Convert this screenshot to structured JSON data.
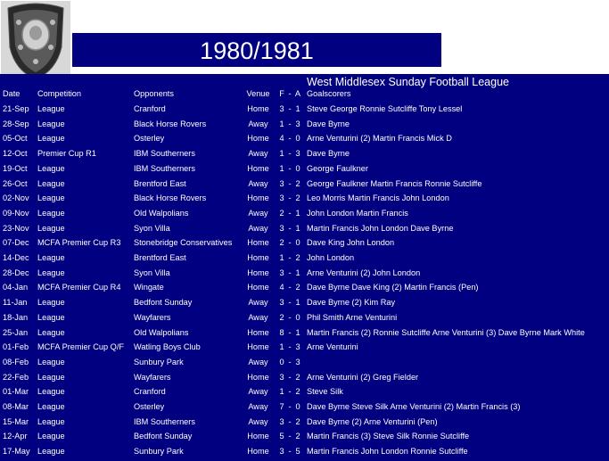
{
  "season_title": "1980/1981",
  "league_name": "West Middlesex Sunday Football League",
  "headers": {
    "date": "Date",
    "competition": "Competition",
    "opponents": "Opponents",
    "venue": "Venue",
    "f": "F",
    "dash": "-",
    "a": "A",
    "goalscorers": "Goalscorers"
  },
  "matches": [
    {
      "date": "21-Sep",
      "competition": "League",
      "opponents": "Cranford",
      "venue": "Home",
      "f": "3",
      "a": "1",
      "goalscorers": "Steve George Ronnie Sutcliffe Tony Lessel"
    },
    {
      "date": "28-Sep",
      "competition": "League",
      "opponents": "Black Horse Rovers",
      "venue": "Away",
      "f": "1",
      "a": "3",
      "goalscorers": "Dave Byrne"
    },
    {
      "date": "05-Oct",
      "competition": "League",
      "opponents": "Osterley",
      "venue": "Home",
      "f": "4",
      "a": "0",
      "goalscorers": "Arne Venturini (2) Martin Francis  Mick D"
    },
    {
      "date": "12-Oct",
      "competition": "Premier Cup R1",
      "opponents": "IBM Southerners",
      "venue": "Away",
      "f": "1",
      "a": "3",
      "goalscorers": "Dave Byrne"
    },
    {
      "date": "19-Oct",
      "competition": "League",
      "opponents": "IBM Southerners",
      "venue": "Home",
      "f": "1",
      "a": "0",
      "goalscorers": "George Faulkner"
    },
    {
      "date": "26-Oct",
      "competition": "League",
      "opponents": "Brentford East",
      "venue": "Away",
      "f": "3",
      "a": "2",
      "goalscorers": "George Faulkner Martin Francis Ronnie Sutcliffe"
    },
    {
      "date": "02-Nov",
      "competition": "League",
      "opponents": "Black Horse Rovers",
      "venue": "Home",
      "f": "3",
      "a": "2",
      "goalscorers": "Leo Morris Martin Francis John London"
    },
    {
      "date": "09-Nov",
      "competition": "League",
      "opponents": "Old Walpolians",
      "venue": "Away",
      "f": "2",
      "a": "1",
      "goalscorers": "John London Martin Francis"
    },
    {
      "date": "23-Nov",
      "competition": "League",
      "opponents": "Syon Villa",
      "venue": "Away",
      "f": "3",
      "a": "1",
      "goalscorers": "Martin Francis John London Dave Byrne"
    },
    {
      "date": "07-Dec",
      "competition": "MCFA Premier Cup R3",
      "opponents": "Stonebridge Conservatives",
      "venue": "Home",
      "f": "2",
      "a": "0",
      "goalscorers": "Dave King John London"
    },
    {
      "date": "14-Dec",
      "competition": "League",
      "opponents": "Brentford East",
      "venue": "Home",
      "f": "1",
      "a": "2",
      "goalscorers": "John London"
    },
    {
      "date": "28-Dec",
      "competition": "League",
      "opponents": "Syon Villa",
      "venue": "Home",
      "f": "3",
      "a": "1",
      "goalscorers": "Arne Venturini (2) John London"
    },
    {
      "date": "04-Jan",
      "competition": "MCFA Premier Cup R4",
      "opponents": "Wingate",
      "venue": "Home",
      "f": "4",
      "a": "2",
      "goalscorers": "Dave Byrne Dave King (2) Martin Francis (Pen)"
    },
    {
      "date": "11-Jan",
      "competition": "League",
      "opponents": "Bedfont Sunday",
      "venue": "Away",
      "f": "3",
      "a": "1",
      "goalscorers": "Dave Byrne (2) Kim Ray"
    },
    {
      "date": "18-Jan",
      "competition": "League",
      "opponents": "Wayfarers",
      "venue": "Away",
      "f": "2",
      "a": "0",
      "goalscorers": "Phil Smith Arne Venturini"
    },
    {
      "date": "25-Jan",
      "competition": "League",
      "opponents": "Old Walpolians",
      "venue": "Home",
      "f": "8",
      "a": "1",
      "goalscorers": "Martin Francis (2) Ronnie Sutcliffe Arne Venturini (3) Dave Byrne Mark White"
    },
    {
      "date": "01-Feb",
      "competition": "MCFA Premier Cup Q/F",
      "opponents": "Watling Boys Club",
      "venue": "Home",
      "f": "1",
      "a": "3",
      "goalscorers": "Arne Venturini"
    },
    {
      "date": "08-Feb",
      "competition": "League",
      "opponents": "Sunbury Park",
      "venue": "Away",
      "f": "0",
      "a": "3",
      "goalscorers": ""
    },
    {
      "date": "22-Feb",
      "competition": "League",
      "opponents": "Wayfarers",
      "venue": "Home",
      "f": "3",
      "a": "2",
      "goalscorers": "Arne Venturini (2) Greg Fielder"
    },
    {
      "date": "01-Mar",
      "competition": "League",
      "opponents": "Cranford",
      "venue": "Away",
      "f": "1",
      "a": "2",
      "goalscorers": "Steve Silk"
    },
    {
      "date": "08-Mar",
      "competition": "League",
      "opponents": "Osterley",
      "venue": "Away",
      "f": "7",
      "a": "0",
      "goalscorers": "Dave Byrne Steve Silk Arne Venturini (2) Martin Francis (3)"
    },
    {
      "date": "15-Mar",
      "competition": "League",
      "opponents": "IBM Southerners",
      "venue": "Away",
      "f": "3",
      "a": "2",
      "goalscorers": "Dave Byrne (2) Arne Venturini (Pen)"
    },
    {
      "date": "12-Apr",
      "competition": "League",
      "opponents": "Bedfont Sunday",
      "venue": "Home",
      "f": "5",
      "a": "2",
      "goalscorers": "Martin Francis (3) Steve Silk Ronnie Sutcliffe"
    },
    {
      "date": "17-May",
      "competition": "League",
      "opponents": "Sunbury Park",
      "venue": "Home",
      "f": "3",
      "a": "5",
      "goalscorers": "Martin Francis John London Ronnie Sutcliffe"
    }
  ]
}
